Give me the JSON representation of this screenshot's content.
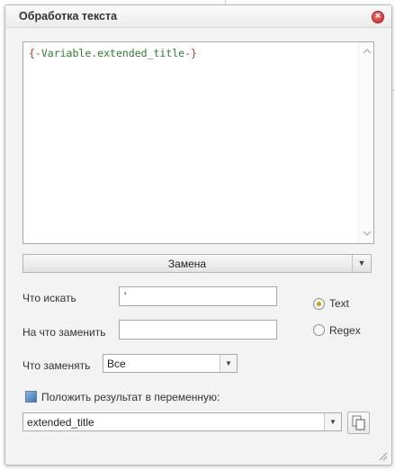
{
  "dialog": {
    "title": "Обработка текста",
    "close_icon": "close-icon"
  },
  "editor": {
    "tokens": {
      "open": "{-",
      "prefix": "Variable.",
      "name": "extended_title",
      "close": "-}"
    },
    "scroll_up_icon": "chevron-up-icon",
    "scroll_down_icon": "chevron-down-icon"
  },
  "mode": {
    "selected": "Замена",
    "arrow_icon": "chevron-down-icon"
  },
  "find": {
    "label": "Что искать",
    "value": "'"
  },
  "replace": {
    "label": "На что заменить",
    "value": ""
  },
  "match_type": {
    "options": [
      "Text",
      "Regex"
    ],
    "selected": "Text"
  },
  "replace_scope": {
    "label": "Что заменять",
    "selected": "Все"
  },
  "save_result": {
    "label": "Положить результат в переменную:",
    "checked": true,
    "variable": "extended_title",
    "copy_icon": "copy-icon"
  },
  "colors": {
    "brace": "#c0392b",
    "variable_name": "#2e7d32",
    "radio_selected": "#d4a017",
    "close_button": "#c62828"
  }
}
